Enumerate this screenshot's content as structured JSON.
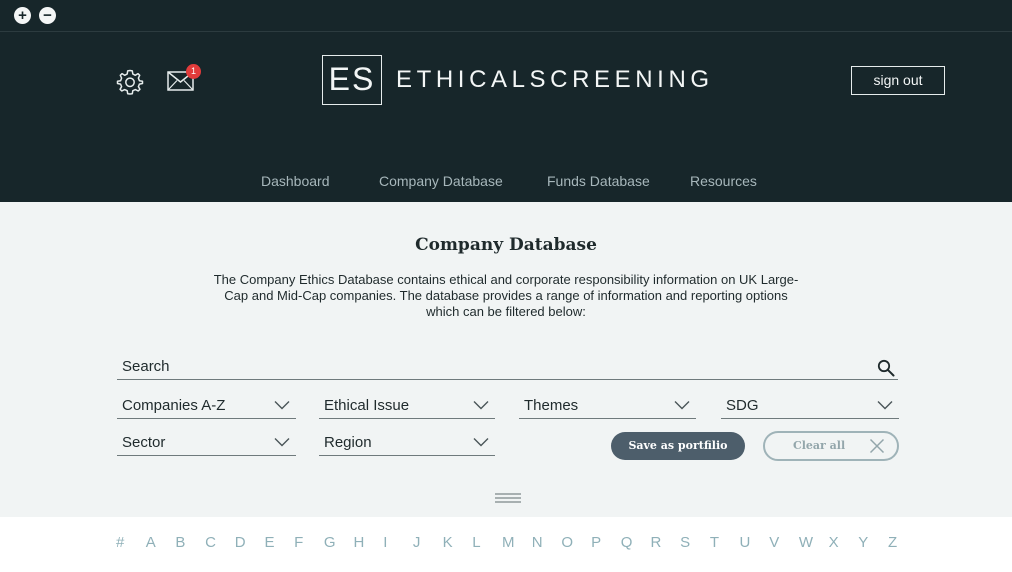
{
  "window": {
    "plus_symbol": "+",
    "minus_symbol": "−"
  },
  "header": {
    "settings_icon": "gear-icon",
    "mail_icon": "envelope-icon",
    "mail_badge": "1",
    "logo_initials": "ES",
    "logo_text": "ETHICALSCREENING",
    "signout_label": "sign out"
  },
  "nav": {
    "items": [
      {
        "label": "Dashboard"
      },
      {
        "label": "Company Database"
      },
      {
        "label": "Funds Database"
      },
      {
        "label": "Resources"
      }
    ]
  },
  "main": {
    "title": "Company Database",
    "description": "The Company Ethics Database contains ethical and corporate responsibility information on UK Large-Cap and Mid-Cap companies. The database provides a range of information and reporting options which can be filtered below:",
    "search": {
      "label": "Search",
      "icon": "search-icon"
    },
    "filters": {
      "companies": "Companies A-Z",
      "ethical_issue": "Ethical Issue",
      "themes": "Themes",
      "sdg": "SDG",
      "sector": "Sector",
      "region": "Region"
    },
    "save_label": "Save as portfilio",
    "clear_label": "Clear all"
  },
  "alphabet": {
    "letters": [
      "#",
      "A",
      "B",
      "C",
      "D",
      "E",
      "F",
      "G",
      "H",
      "I",
      "J",
      "K",
      "L",
      "M",
      "N",
      "O",
      "P",
      "Q",
      "R",
      "S",
      "T",
      "U",
      "V",
      "W",
      "X",
      "Y",
      "Z"
    ]
  },
  "colors": {
    "header_bg": "#17262a",
    "main_bg": "#f1f4f4",
    "nav_text": "#a7b7bb",
    "badge": "#e23b3b",
    "save_button": "#4d5e6b",
    "alphabet_text": "#8fb0b8"
  }
}
